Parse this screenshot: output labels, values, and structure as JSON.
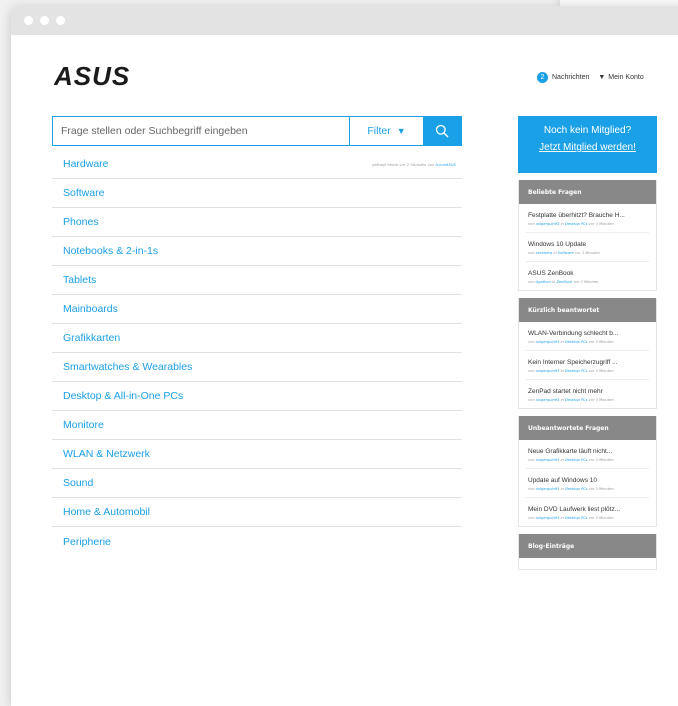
{
  "header": {
    "logo": "ASUS",
    "messages_count": "2",
    "messages_label": "Nachrichten",
    "account_label": "Mein Konto"
  },
  "search": {
    "placeholder": "Frage stellen oder Suchbegriff eingeben",
    "filter_label": "Filter"
  },
  "categories": [
    {
      "name": "Hardware",
      "meta": {
        "prefix": "gefragt heute vor 2 Stunden von",
        "user": "ILoveASUS"
      }
    },
    {
      "name": "Software"
    },
    {
      "name": "Phones"
    },
    {
      "name": "Notebooks & 2-in-1s"
    },
    {
      "name": "Tablets"
    },
    {
      "name": "Mainboards"
    },
    {
      "name": "Grafikkarten"
    },
    {
      "name": "Smartwatches & Wearables"
    },
    {
      "name": "Desktop & All-in-One PCs"
    },
    {
      "name": "Monitore"
    },
    {
      "name": "WLAN & Netzwerk"
    },
    {
      "name": "Sound"
    },
    {
      "name": "Home & Automobil"
    },
    {
      "name": "Peripherie"
    }
  ],
  "promo": {
    "line1": "Noch kein Mitglied?",
    "line2": "Jetzt Mitglied werden!"
  },
  "panels": {
    "popular": {
      "title": "Beliebte Fragen",
      "items": [
        {
          "title": "Festplatte überhitzt? Brauche H...",
          "meta": {
            "p1": "von",
            "user": "xxlgerguin93",
            "p2": "in",
            "cat": "Desktop PCs",
            "p3": "vor 3 Minuten"
          }
        },
        {
          "title": "Windows 10 Update",
          "meta": {
            "p1": "von",
            "user": "zeckberg",
            "p2": "in",
            "cat": "Software",
            "p3": "vor 3 Minuten"
          }
        },
        {
          "title": "ASUS ZenBook",
          "meta": {
            "p1": "von",
            "user": "Agathon",
            "p2": "in",
            "cat": "ZenBook",
            "p3": "vor 3 Minuten"
          }
        }
      ]
    },
    "answered": {
      "title": "Kürzlich beantwortet",
      "items": [
        {
          "title": "WLAN-Verbindung schlecht b...",
          "meta": {
            "p1": "von",
            "user": "xxlgerguin93",
            "p2": "in",
            "cat": "Desktop PCs",
            "p3": "vor 3 Minuten"
          }
        },
        {
          "title": "Kein Interner Speicherzugriff ...",
          "meta": {
            "p1": "von",
            "user": "xxlgerguin93",
            "p2": "in",
            "cat": "Desktop PCs",
            "p3": "vor 3 Minuten"
          }
        },
        {
          "title": "ZenPad startet nicht mehr",
          "meta": {
            "p1": "von",
            "user": "xxlgerguin93",
            "p2": "in",
            "cat": "Desktop PCs",
            "p3": "vor 3 Minuten"
          }
        }
      ]
    },
    "unanswered": {
      "title": "Unbeantwortete Fragen",
      "items": [
        {
          "title": "Neue Grafikkarte läuft nicht...",
          "meta": {
            "p1": "von",
            "user": "xxlgerguin93",
            "p2": "in",
            "cat": "Desktop PCs",
            "p3": "vor 3 Minuten"
          }
        },
        {
          "title": "Update auf Windows 10",
          "meta": {
            "p1": "von",
            "user": "xxlgerguin93",
            "p2": "in",
            "cat": "Desktop PCs",
            "p3": "vor 3 Minuten"
          }
        },
        {
          "title": "Mein DVD Laufwerk liest plötz...",
          "meta": {
            "p1": "von",
            "user": "xxlgerguin93",
            "p2": "in",
            "cat": "Desktop PCs",
            "p3": "vor 3 Minuten"
          }
        }
      ]
    },
    "blog": {
      "title": "Blog-Einträge"
    }
  },
  "colors": {
    "accent": "#1aa0e6",
    "panel_header": "#888888",
    "titlebar": "#e3e3e3"
  }
}
